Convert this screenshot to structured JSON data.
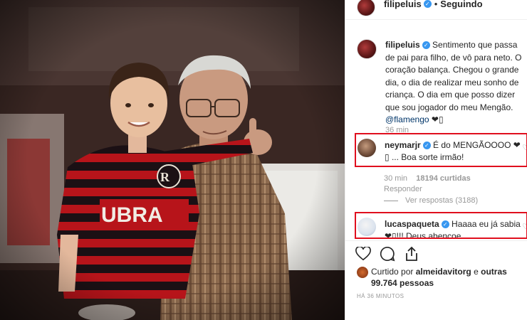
{
  "post": {
    "author": "filipeluis",
    "follow_label": "Seguindo",
    "dot": "•",
    "caption": "Sentimento que passa de pai para filho, de vô para neto. O coração balança. Chegou o grande dia, o dia de realizar meu sonho de criança. O dia em que posso dizer que sou jogador do meu Mengão.",
    "caption_mention": "@flamengo",
    "caption_emoji": "❤▯",
    "caption_time": "36 min"
  },
  "comments": [
    {
      "user": "neymarjr",
      "text": "É do MENGÃOOOO ❤▯ ... Boa sorte irmão!",
      "time": "30 min",
      "likes": "18194 curtidas",
      "reply": "Responder",
      "view_replies": "Ver respostas (3188)"
    },
    {
      "user": "lucaspaqueta",
      "text": "Haaaa eu já sabia ❤▯!!! Deus abençoe"
    }
  ],
  "likes_summary": {
    "prefix": "Curtido por",
    "user": "almeidavitorg",
    "joiner": "e",
    "others": "outras 99.764 pessoas"
  },
  "timestamp": "HÁ 36 MINUTOS",
  "colors": {
    "highlight_border": "#e00f1e",
    "verified": "#3897f0",
    "muted": "#999999"
  }
}
